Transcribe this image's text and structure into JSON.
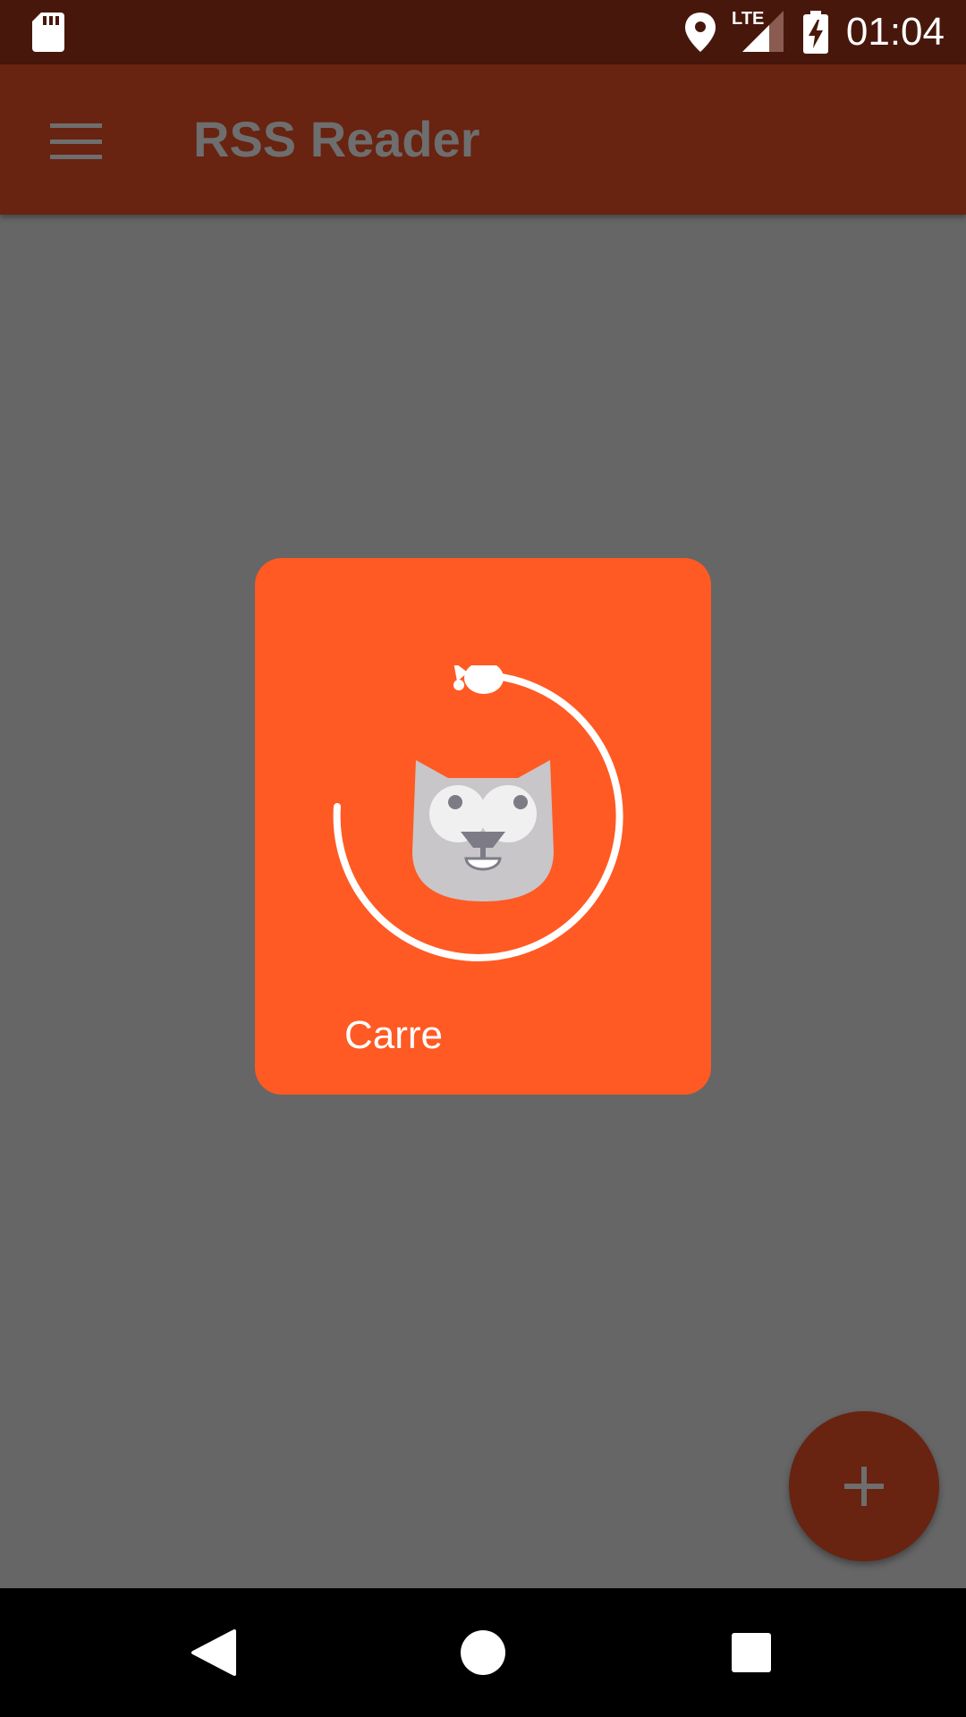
{
  "status_bar": {
    "time": "01:04",
    "network": "LTE",
    "icons": [
      "sd-card-icon",
      "location-icon",
      "signal-icon",
      "battery-charging-icon"
    ]
  },
  "app_bar": {
    "title": "RSS Reader",
    "menu_icon": "hamburger-menu-icon"
  },
  "loading_dialog": {
    "label": "Carre",
    "icon": "cat-face-icon",
    "spinner": "circular-progress-icon",
    "accent_color": "#ff5a24"
  },
  "fab": {
    "icon": "plus-icon"
  },
  "nav_bar": {
    "buttons": [
      "back-icon",
      "home-icon",
      "recents-icon"
    ]
  },
  "colors": {
    "status_bar": "#48170b",
    "app_bar": "#682311",
    "scrim": "#666666",
    "card": "#ff5a24"
  }
}
